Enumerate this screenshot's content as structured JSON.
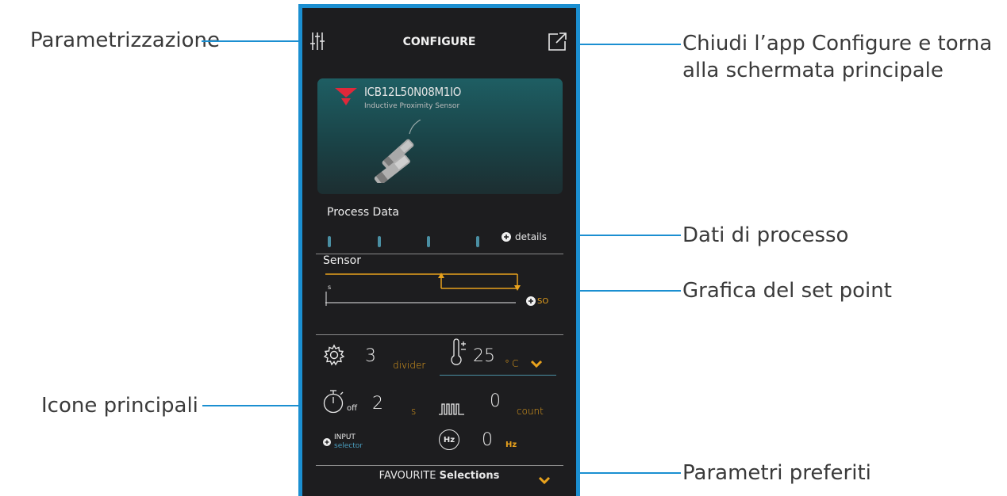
{
  "callouts": {
    "parametrization": "Parametrizzazione",
    "close_app_line1": "Chiudi l’app Configure e torna",
    "close_app_line2": "alla schermata principale",
    "process_data": "Dati di processo",
    "setpoint_graphic": "Grafica del set point",
    "main_icons": "Icone principali",
    "favourite_params": "Parametri preferiti"
  },
  "app": {
    "title": "CONFIGURE",
    "product": {
      "code": "ICB12L50N08M1IO",
      "description": "Inductive Proximity Sensor"
    },
    "process_data": {
      "label": "Process Data",
      "details_label": "details"
    },
    "sensor": {
      "label": "Sensor",
      "axis_start": "s",
      "axis_end": "SO"
    },
    "icons": {
      "divider": {
        "value": "3",
        "unit": "divider"
      },
      "temperature": {
        "value": "25",
        "unit": "°C"
      },
      "timer": {
        "suffix": "off",
        "value": "2",
        "unit": "s"
      },
      "counter": {
        "value": "0",
        "unit": "count"
      },
      "frequency": {
        "icon_text": "Hz",
        "value": "0",
        "unit": "Hz"
      },
      "input": {
        "line1": "INPUT",
        "line2": "selector"
      }
    },
    "favourites": {
      "prefix": "FAVOURITE",
      "bold": "Selections"
    }
  },
  "colors": {
    "accent": "#1b8fd1",
    "orange": "#e8a21d",
    "teal": "#4a8fa3"
  }
}
